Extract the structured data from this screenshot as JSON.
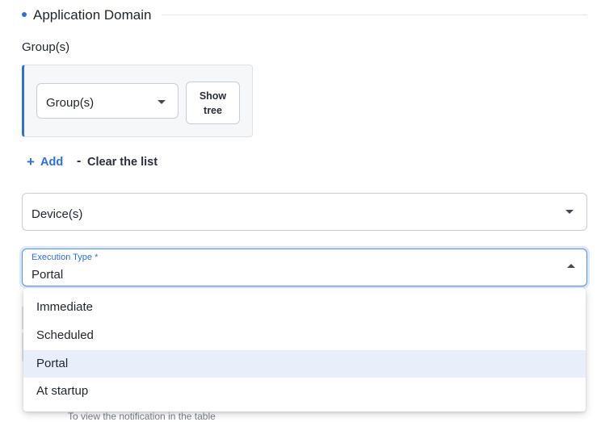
{
  "section": {
    "title": "Application Domain"
  },
  "groups": {
    "label": "Group(s)",
    "select_placeholder": "Group(s)",
    "show_tree_line1": "Show",
    "show_tree_line2": "tree"
  },
  "actions": {
    "add_label": "Add",
    "clear_label": "Clear the list"
  },
  "device": {
    "placeholder": "Device(s)"
  },
  "execution": {
    "label": "Execution Type *",
    "value": "Portal",
    "options": [
      "Immediate",
      "Scheduled",
      "Portal",
      "At startup"
    ],
    "selected_index": 2
  },
  "background": {
    "note": "To view the notification in the table"
  },
  "colors": {
    "accent": "#2d6fe3",
    "selected_bg": "#e8effb"
  }
}
